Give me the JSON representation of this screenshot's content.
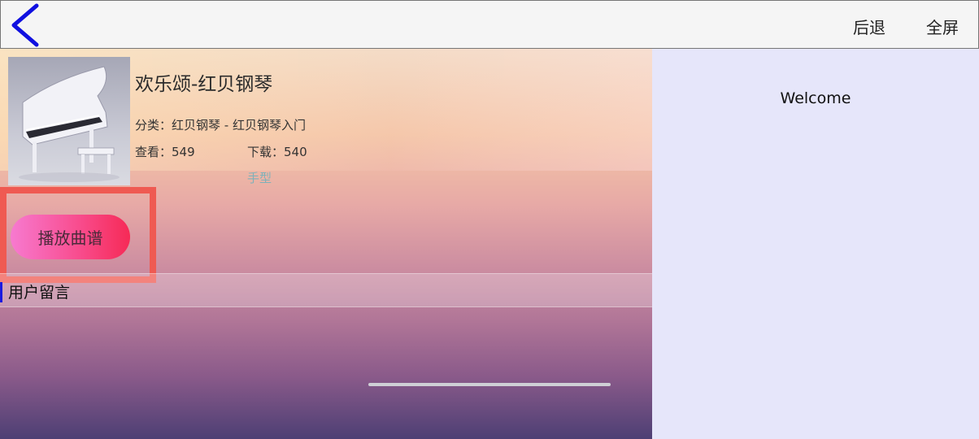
{
  "topbar": {
    "back_icon": "chevron-left-icon",
    "back_color": "#1010e0",
    "back_label": "后退",
    "fullscreen_label": "全屏"
  },
  "song": {
    "title": "欢乐颂-红贝钢琴",
    "category": "分类：红贝钢琴 - 红贝钢琴入门",
    "views": "查看：549",
    "downloads": "下载：540",
    "hand_link": "手型",
    "thumbnail_icon": "grand-piano-image"
  },
  "play_button": {
    "label": "播放曲谱"
  },
  "comments": {
    "title": "用户留言"
  },
  "right_panel": {
    "welcome": "Welcome"
  },
  "colors": {
    "highlight_border": "#ef5a52",
    "accent_blue": "#1a1adf",
    "right_panel_bg": "#e6e6fa"
  }
}
